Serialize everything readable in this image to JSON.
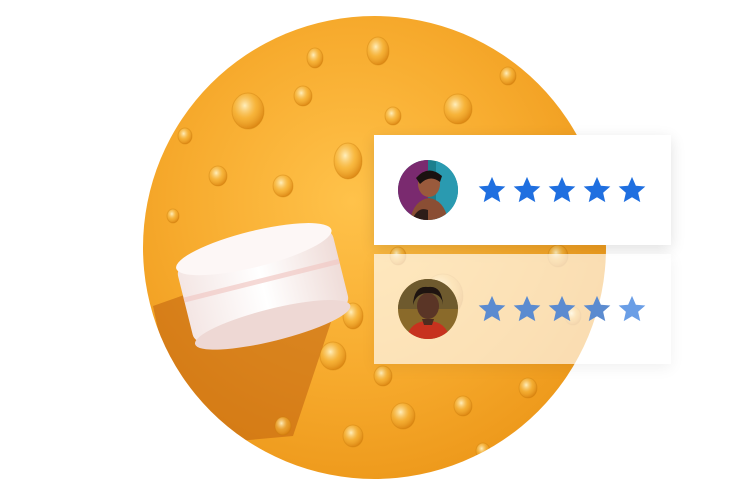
{
  "hero": {
    "image": "skincare-jar-on-orange-water-droplets",
    "colors": {
      "background": "#f7ab2e",
      "jar": "#fbf3f3",
      "shadow": "#b8520b"
    }
  },
  "reviews": [
    {
      "avatar": "woman-portrait-avatar",
      "rating": 5,
      "star_color": "#1f6fe0",
      "muted": false
    },
    {
      "avatar": "woman-portrait-avatar",
      "rating": 5,
      "star_color": "#5b8bd0",
      "muted": true
    }
  ],
  "icons": {
    "star": "star-icon"
  }
}
